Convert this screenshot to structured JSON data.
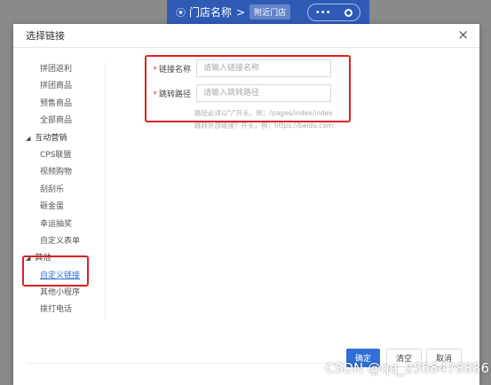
{
  "background": {
    "location_label": "门店名称",
    "location_icon": "map-pin-icon",
    "chevron": ">",
    "nearby_label": "附近门店",
    "capsule_dots": "•••"
  },
  "dialog": {
    "title": "选择链接",
    "close_icon": "×"
  },
  "tree": {
    "pre_items": [
      "拼团返利",
      "拼团商品",
      "预售商品",
      "全部商品"
    ],
    "group_marketing": {
      "arrow": "◢",
      "label": "互动营销"
    },
    "marketing_items": [
      "CPS联盟",
      "视频购物",
      "刮刮乐",
      "砸金蛋",
      "幸运抽奖",
      "自定义表单"
    ],
    "group_other": {
      "arrow": "◢",
      "label": "其他"
    },
    "other_items": [
      "自定义链接",
      "其他小程序",
      "拨打电话"
    ],
    "active_item": "自定义链接"
  },
  "form": {
    "required_mark": "*",
    "name_label": "链接名称",
    "name_placeholder": "请输入链接名称",
    "path_label": "跳转路径",
    "path_placeholder": "请输入跳转路径",
    "hint_path": "路径必须以\"/\"开头，例：/pages/index/index",
    "hint_external": "跳转外部链接？开头，例：https://baidu.com"
  },
  "footer": {
    "confirm_label": "确定",
    "clear_label": "清空",
    "cancel_label": "取消"
  },
  "watermark": "CSDN @qq_2568478886",
  "colors": {
    "primary": "#2f6fd6",
    "highlight_red": "#e02020",
    "header_blue": "#2f5bb7",
    "required_red": "#e4393c"
  }
}
